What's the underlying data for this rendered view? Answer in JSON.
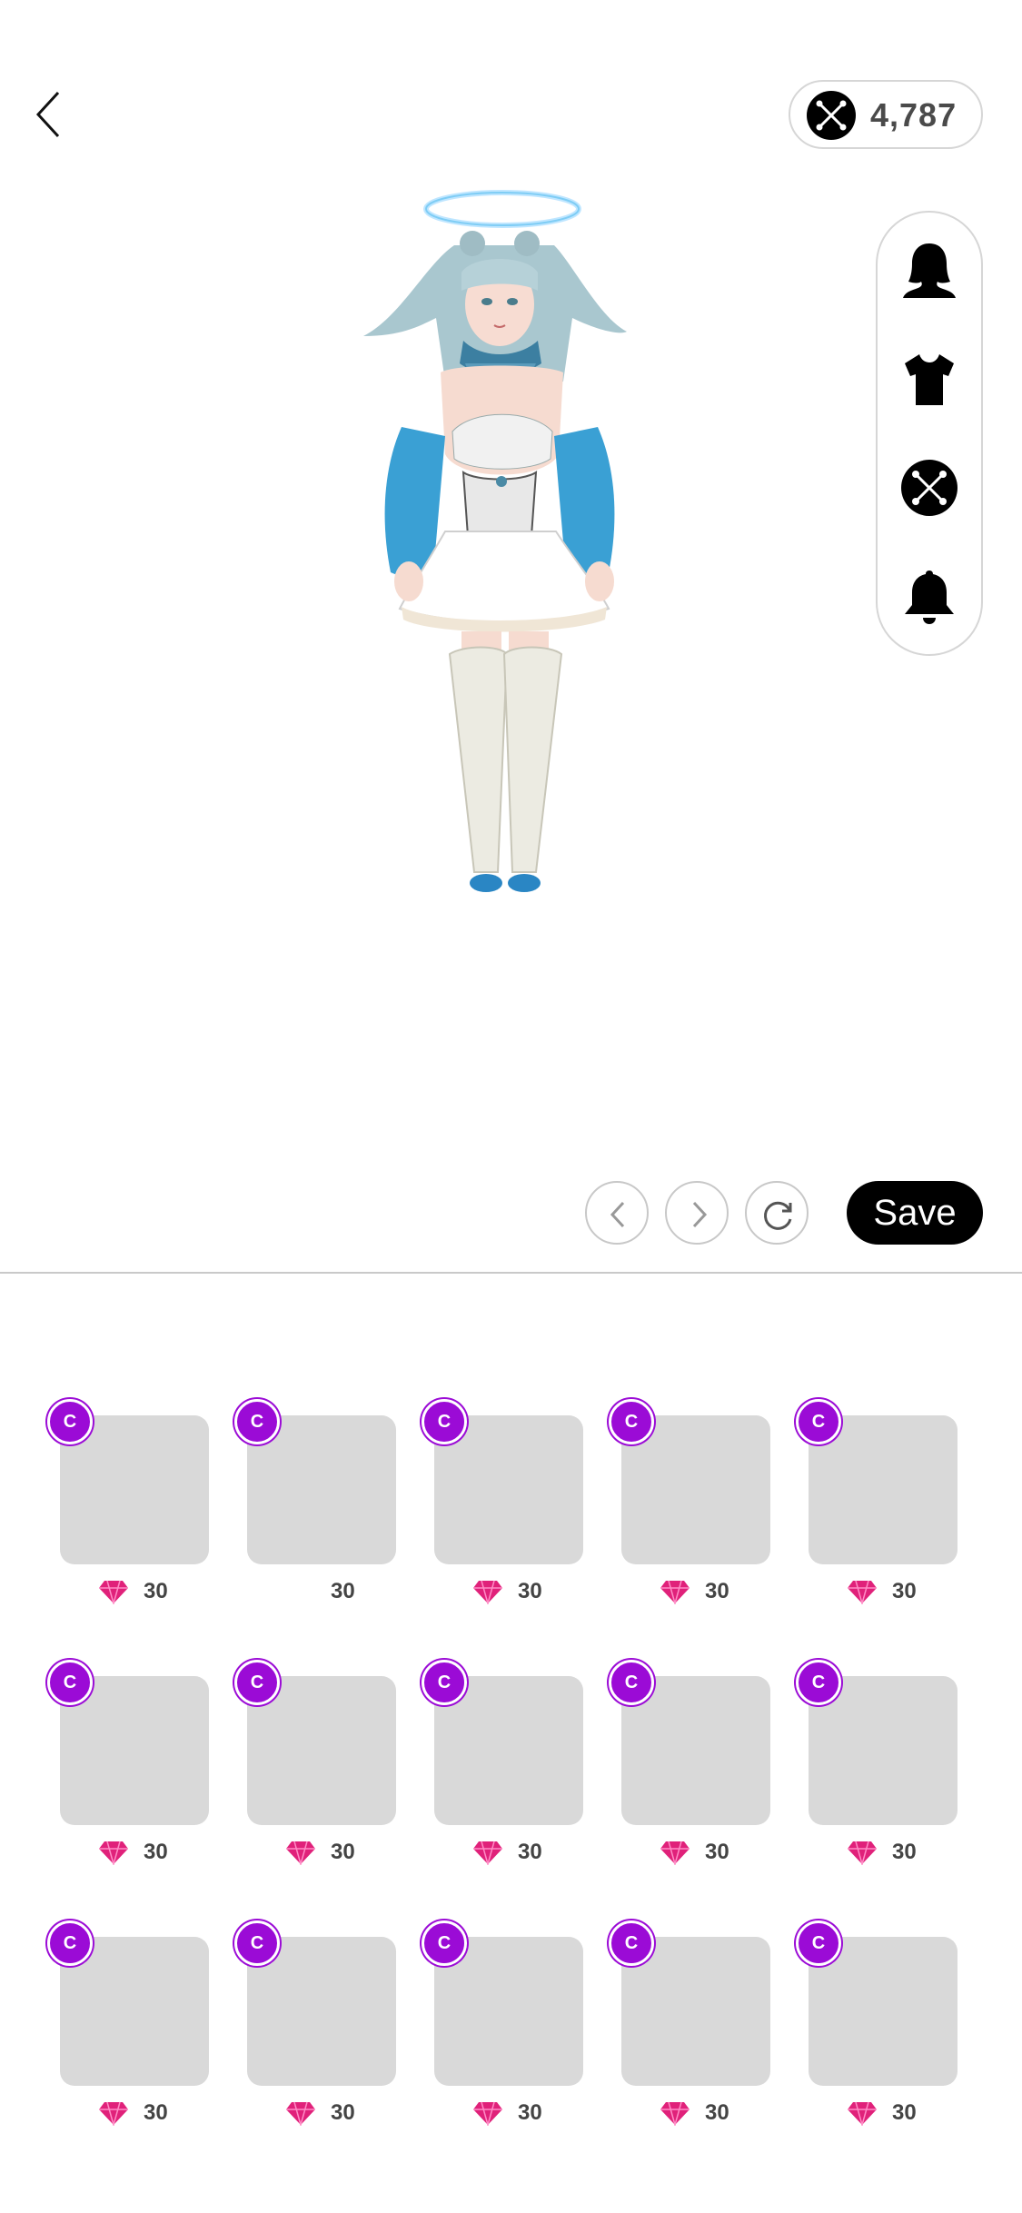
{
  "header": {
    "back_icon": "chevron-left-icon",
    "currency": {
      "icon": "crystal-token-icon",
      "value": "4,787"
    }
  },
  "category_panel": {
    "items": [
      {
        "name": "hair",
        "icon": "hair-silhouette-icon"
      },
      {
        "name": "outfit",
        "icon": "tshirt-icon"
      },
      {
        "name": "accessories",
        "icon": "crystal-token-icon"
      },
      {
        "name": "notifications",
        "icon": "bell-icon"
      }
    ]
  },
  "avatar": {
    "description": "character-preview",
    "accent_color": "#3fa3d6"
  },
  "controls": {
    "undo_icon": "chevron-left-icon",
    "redo_icon": "chevron-right-icon",
    "reset_icon": "refresh-icon",
    "save_label": "Save"
  },
  "colors": {
    "rarity": "#9b0bd6",
    "gem": "#e0217a",
    "thumb": "#d9d9d9"
  },
  "items": [
    {
      "rarity": "C",
      "price": "30",
      "gem": true
    },
    {
      "rarity": "C",
      "price": "30",
      "gem": false
    },
    {
      "rarity": "C",
      "price": "30",
      "gem": true
    },
    {
      "rarity": "C",
      "price": "30",
      "gem": true
    },
    {
      "rarity": "C",
      "price": "30",
      "gem": true
    },
    {
      "rarity": "C",
      "price": "30",
      "gem": true
    },
    {
      "rarity": "C",
      "price": "30",
      "gem": true
    },
    {
      "rarity": "C",
      "price": "30",
      "gem": true
    },
    {
      "rarity": "C",
      "price": "30",
      "gem": true
    },
    {
      "rarity": "C",
      "price": "30",
      "gem": true
    },
    {
      "rarity": "C",
      "price": "30",
      "gem": true
    },
    {
      "rarity": "C",
      "price": "30",
      "gem": true
    },
    {
      "rarity": "C",
      "price": "30",
      "gem": true
    },
    {
      "rarity": "C",
      "price": "30",
      "gem": true
    },
    {
      "rarity": "C",
      "price": "30",
      "gem": true
    }
  ]
}
